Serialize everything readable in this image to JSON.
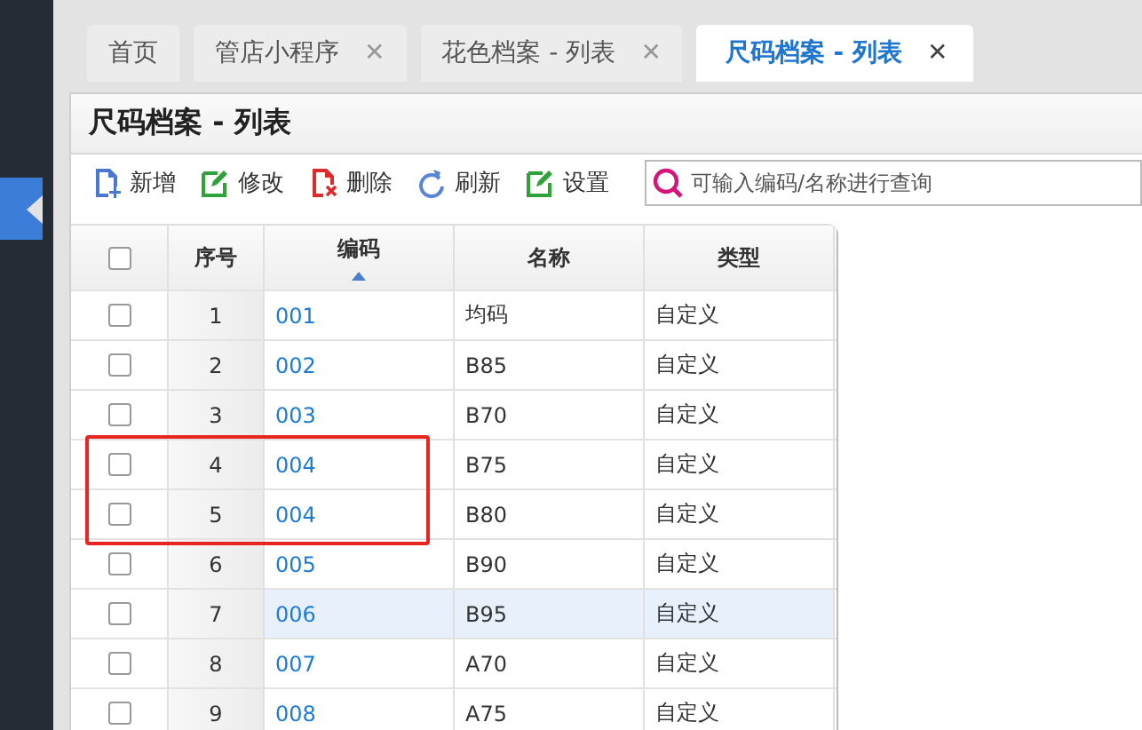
{
  "tabs": [
    {
      "label": "首页",
      "selected": false
    },
    {
      "label": "管店小程序",
      "selected": false,
      "close": "✕"
    },
    {
      "label": "花色档案 - 列表",
      "selected": false,
      "close": "✕"
    },
    {
      "label": "尺码档案 - 列表",
      "selected": true,
      "close": "✕"
    }
  ],
  "panel": {
    "title": "尺码档案 - 列表"
  },
  "toolbar": [
    {
      "kind": "add",
      "label": "新增"
    },
    {
      "kind": "edit",
      "label": "修改"
    },
    {
      "kind": "delete",
      "label": "删除"
    },
    {
      "kind": "refresh",
      "label": "刷新"
    },
    {
      "kind": "edit",
      "label": "设置"
    }
  ],
  "search": {
    "placeholder": "可输入编码/名称进行查询"
  },
  "table": {
    "columns": [
      {
        "label": "序号",
        "sorted": false
      },
      {
        "label": "编码",
        "sorted": true
      },
      {
        "label": "名称",
        "sorted": false
      },
      {
        "label": "类型",
        "sorted": false
      }
    ],
    "all_checked": false,
    "rows": [
      {
        "no": "1",
        "code": "001",
        "name": "均码",
        "type": "自定义",
        "checked": false,
        "selected": false,
        "marked": false
      },
      {
        "no": "2",
        "code": "002",
        "name": "B85",
        "type": "自定义",
        "checked": false,
        "selected": false,
        "marked": false
      },
      {
        "no": "3",
        "code": "003",
        "name": "B70",
        "type": "自定义",
        "checked": false,
        "selected": false,
        "marked": false
      },
      {
        "no": "4",
        "code": "004",
        "name": "B75",
        "type": "自定义",
        "checked": false,
        "selected": false,
        "marked": true
      },
      {
        "no": "5",
        "code": "004",
        "name": "B80",
        "type": "自定义",
        "checked": false,
        "selected": false,
        "marked": true
      },
      {
        "no": "6",
        "code": "005",
        "name": "B90",
        "type": "自定义",
        "checked": false,
        "selected": false,
        "marked": false
      },
      {
        "no": "7",
        "code": "006",
        "name": "B95",
        "type": "自定义",
        "checked": false,
        "selected": true,
        "marked": false
      },
      {
        "no": "8",
        "code": "007",
        "name": "A70",
        "type": "自定义",
        "checked": false,
        "selected": false,
        "marked": false
      },
      {
        "no": "9",
        "code": "008",
        "name": "A75",
        "type": "自定义",
        "checked": false,
        "selected": false,
        "marked": false
      }
    ]
  }
}
